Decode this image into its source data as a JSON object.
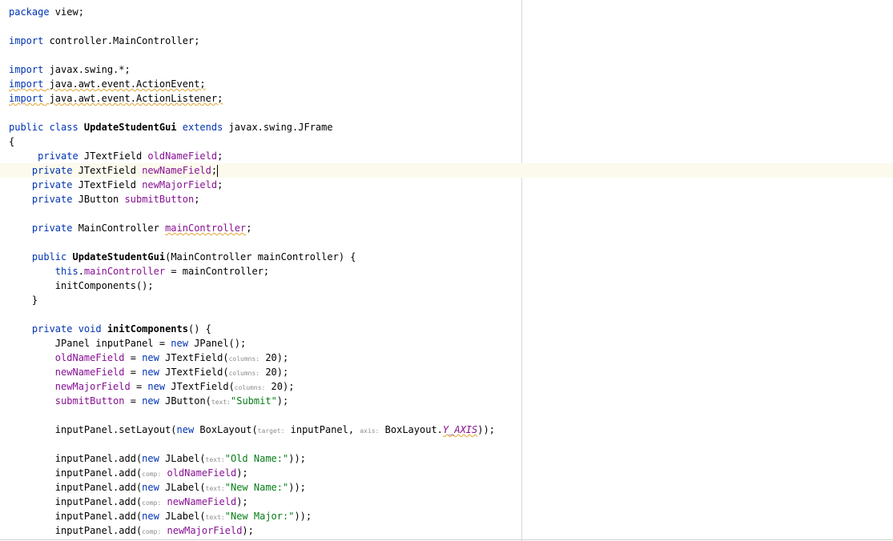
{
  "editor": {
    "lines": {
      "l1": {
        "a": "package",
        "b": " view;"
      },
      "l3": {
        "a": "import",
        "b": " controller.MainController;"
      },
      "l5": {
        "a": "import",
        "b": " javax.swing.*;"
      },
      "l6": {
        "a": "import",
        "b": " java.awt.event.ActionEvent;"
      },
      "l7": {
        "a": "import",
        "b": " java.awt.event.ActionListener;"
      },
      "l9": {
        "a": "public class",
        "b": " UpdateStudentGui ",
        "c": "extends",
        "d": " javax.swing.JFrame"
      },
      "l10": {
        "a": "{"
      },
      "l11": {
        "a": "private",
        "b": " JTextField ",
        "c": "oldNameField",
        "d": ";"
      },
      "l12": {
        "a": "private",
        "b": " JTextField ",
        "c": "newNameField",
        "d": ";"
      },
      "l13": {
        "a": "private",
        "b": " JTextField ",
        "c": "newMajorField",
        "d": ";"
      },
      "l14": {
        "a": "private",
        "b": " JButton ",
        "c": "submitButton",
        "d": ";"
      },
      "l16": {
        "a": "private",
        "b": " MainController ",
        "c": "mainController",
        "d": ";"
      },
      "l18": {
        "a": "public",
        "b": " UpdateStudentGui",
        "c": "(MainController mainController) {"
      },
      "l19": {
        "a": "this",
        "b": ".",
        "c": "mainController",
        "d": " = mainController;"
      },
      "l20": {
        "a": "initComponents();"
      },
      "l21": {
        "a": "}"
      },
      "l23": {
        "a": "private void",
        "b": " initComponents",
        "c": "() {"
      },
      "l24": {
        "a": "JPanel inputPanel = ",
        "b": "new",
        "c": " JPanel();"
      },
      "l25": {
        "a": "oldNameField",
        "b": " = ",
        "c": "new",
        "d": " JTextField(",
        "e": "columns:",
        "f": " 20);"
      },
      "l26": {
        "a": "newNameField",
        "b": " = ",
        "c": "new",
        "d": " JTextField(",
        "e": "columns:",
        "f": " 20);"
      },
      "l27": {
        "a": "newMajorField",
        "b": " = ",
        "c": "new",
        "d": " JTextField(",
        "e": "columns:",
        "f": " 20);"
      },
      "l28": {
        "a": "submitButton",
        "b": " = ",
        "c": "new",
        "d": " JButton(",
        "e": "text:",
        "f": "\"Submit\"",
        "g": ");"
      },
      "l30": {
        "a": "inputPanel.setLayout(",
        "b": "new",
        "c": " BoxLayout(",
        "d": "target:",
        "e": " inputPanel, ",
        "f": "axis:",
        "g": " BoxLayout.",
        "h": "Y_AXIS",
        "i": "));"
      },
      "l32": {
        "a": "inputPanel.add(",
        "b": "new",
        "c": " JLabel(",
        "d": "text:",
        "e": "\"Old Name:\"",
        "f": "));"
      },
      "l33": {
        "a": "inputPanel.add(",
        "b": "comp:",
        "c": " ",
        "d": "oldNameField",
        "e": ");"
      },
      "l34": {
        "a": "inputPanel.add(",
        "b": "new",
        "c": " JLabel(",
        "d": "text:",
        "e": "\"New Name:\"",
        "f": "));"
      },
      "l35": {
        "a": "inputPanel.add(",
        "b": "comp:",
        "c": " ",
        "d": "newNameField",
        "e": ");"
      },
      "l36": {
        "a": "inputPanel.add(",
        "b": "new",
        "c": " JLabel(",
        "d": "text:",
        "e": "\"New Major:\"",
        "f": "));"
      },
      "l37": {
        "a": "inputPanel.add(",
        "b": "comp:",
        "c": " ",
        "d": "newMajorField",
        "e": ");"
      }
    }
  }
}
